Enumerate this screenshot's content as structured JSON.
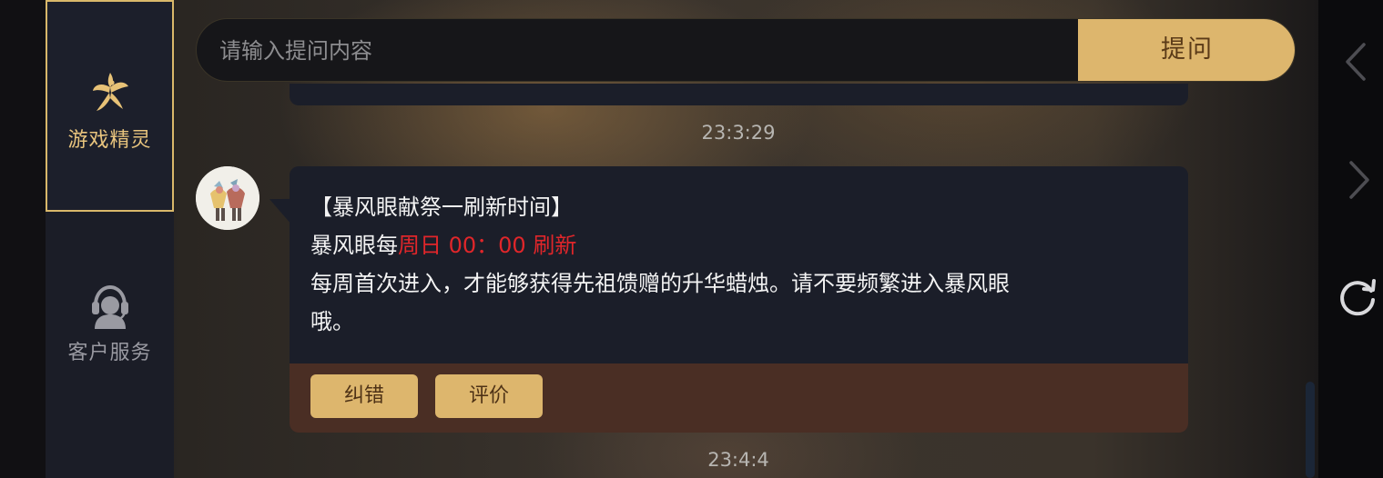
{
  "sidebar": {
    "items": [
      {
        "label": "游戏精灵",
        "icon": "fairy-icon",
        "active": true
      },
      {
        "label": "客户服务",
        "icon": "customer-service-icon",
        "active": false
      }
    ]
  },
  "search": {
    "placeholder": "请输入提问内容",
    "value": "",
    "button_label": "提问"
  },
  "chat": {
    "timestamps": [
      "23:3:29",
      "23:4:4"
    ],
    "message": {
      "title": "【暴风眼献祭一刷新时间】",
      "line2_prefix": "暴风眼每",
      "line2_highlight": "周日 00：00 刷新",
      "line3": "每周首次进入，才能够获得先祖馈赠的升华蜡烛。请不要频繁进入暴风眼",
      "line4": "哦。",
      "actions": [
        "纠错",
        "评价"
      ]
    }
  },
  "nav": {
    "icons": [
      "back-arrow-icon",
      "forward-arrow-icon",
      "refresh-icon"
    ]
  },
  "colors": {
    "accent": "#ddb66d",
    "highlight_red": "#e0262a",
    "bubble_bg": "#1b1e29",
    "footer_bg": "#4a2e24"
  }
}
